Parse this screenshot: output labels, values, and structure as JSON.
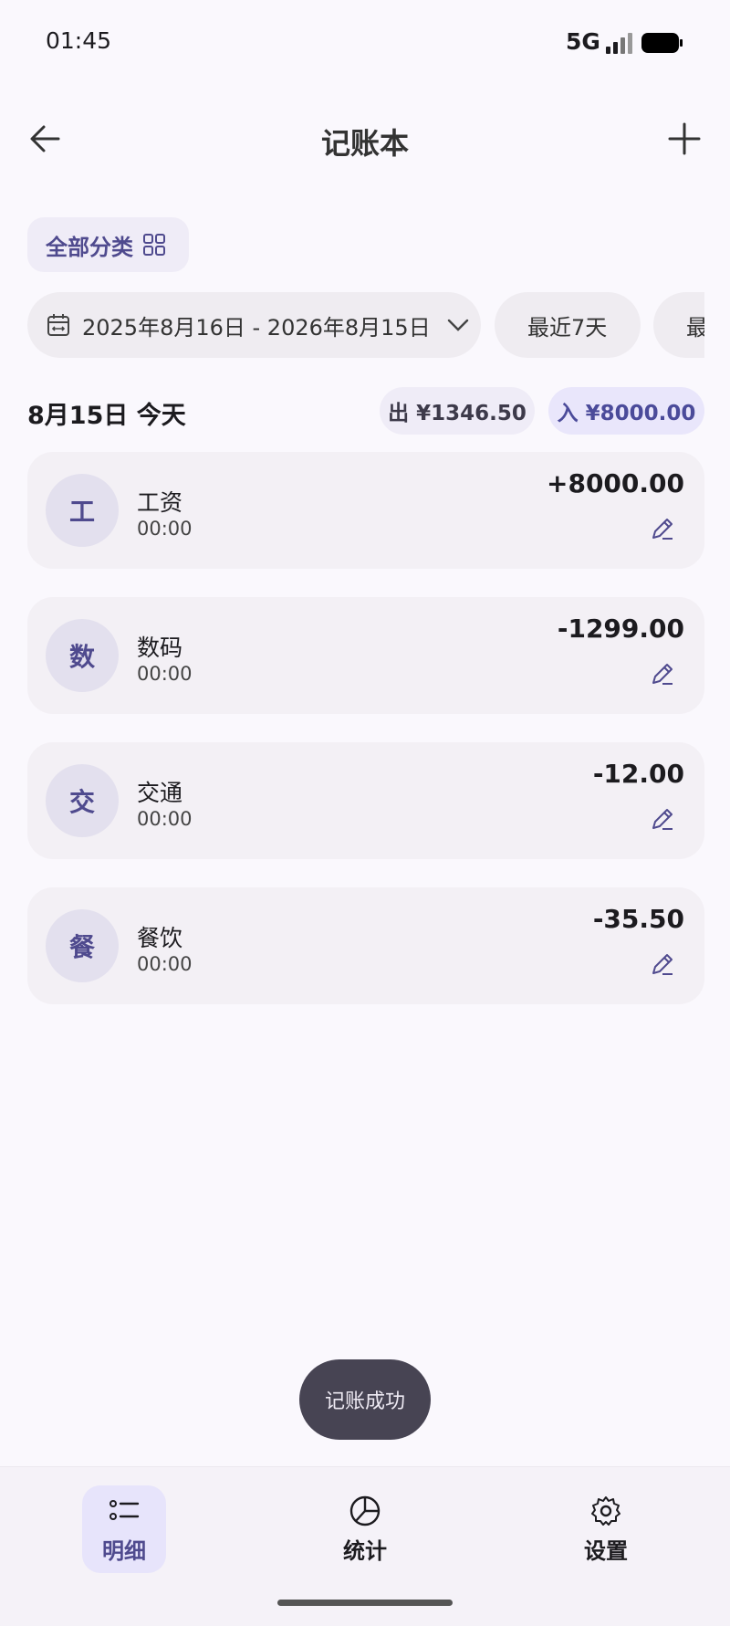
{
  "status_bar": {
    "time": "01:45",
    "network": "5G"
  },
  "app_bar": {
    "title": "记账本"
  },
  "category_chip": {
    "label": "全部分类"
  },
  "filters": {
    "date_range": "2025年8月16日 - 2026年8月15日",
    "quick_ranges": [
      "最近7天",
      "最"
    ]
  },
  "day_group": {
    "title": "8月15日 今天",
    "expense": "出 ¥1346.50",
    "income": "入 ¥8000.00"
  },
  "transactions": [
    {
      "icon_char": "工",
      "category": "工资",
      "time": "00:00",
      "amount": "+8000.00"
    },
    {
      "icon_char": "数",
      "category": "数码",
      "time": "00:00",
      "amount": "-1299.00"
    },
    {
      "icon_char": "交",
      "category": "交通",
      "time": "00:00",
      "amount": "-12.00"
    },
    {
      "icon_char": "餐",
      "category": "餐饮",
      "time": "00:00",
      "amount": "-35.50"
    }
  ],
  "toast": {
    "message": "记账成功"
  },
  "bottom_nav": {
    "items": [
      {
        "label": "明细",
        "icon": "list-icon",
        "active": true
      },
      {
        "label": "统计",
        "icon": "pie-chart-icon",
        "active": false
      },
      {
        "label": "设置",
        "icon": "gear-icon",
        "active": false
      }
    ]
  },
  "colors": {
    "accent": "#4f4a8e",
    "background": "#faf8fd",
    "card": "#f3f0f5"
  }
}
